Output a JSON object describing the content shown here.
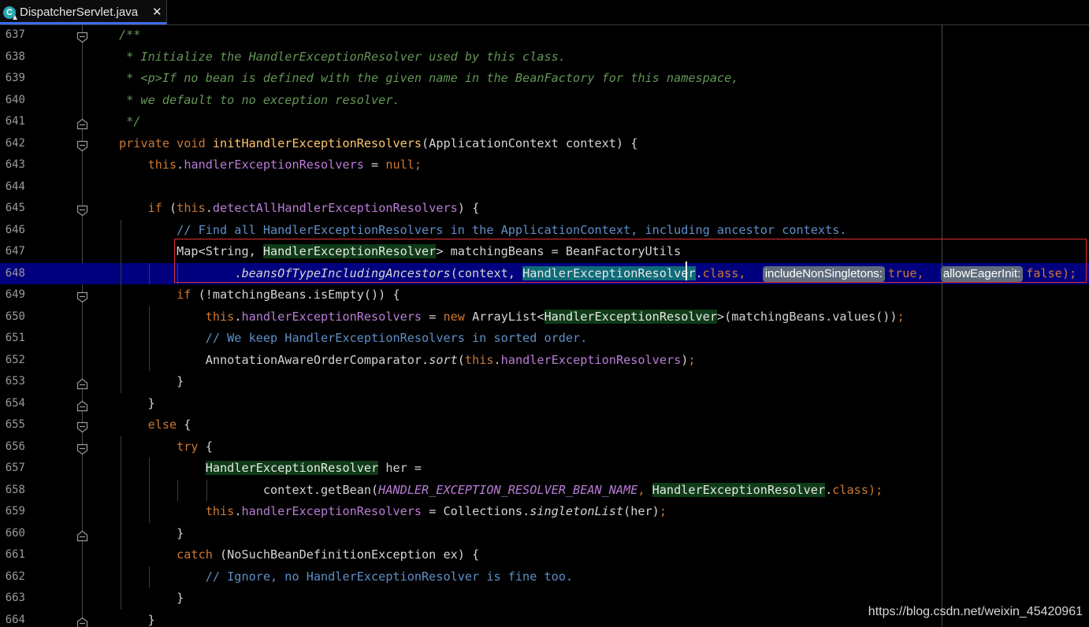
{
  "tab": {
    "title": "DispatcherServlet.java",
    "icon_letter": "C",
    "close_glyph": "✕"
  },
  "watermark": "https://blog.csdn.net/weixin_45420961",
  "current_line": "648",
  "lines": [
    {
      "n": "637",
      "fold": "open",
      "segs": [
        [
          "c-doc",
          "/**"
        ]
      ]
    },
    {
      "n": "638",
      "fold": "",
      "segs": [
        [
          "c-doc",
          " * Initialize the HandlerExceptionResolver used by this class."
        ]
      ]
    },
    {
      "n": "639",
      "fold": "",
      "segs": [
        [
          "c-doc",
          " * <p>If no bean is defined with the given name in the BeanFactory for this namespace,"
        ]
      ]
    },
    {
      "n": "640",
      "fold": "",
      "segs": [
        [
          "c-doc",
          " * we default to no exception resolver."
        ]
      ]
    },
    {
      "n": "641",
      "fold": "close",
      "segs": [
        [
          "c-doc",
          " */"
        ]
      ]
    },
    {
      "n": "642",
      "fold": "open",
      "segs": [
        [
          "c-kw",
          "private void "
        ],
        [
          "c-fn",
          "initHandlerExceptionResolvers"
        ],
        [
          "c-pl",
          "(ApplicationContext context) {"
        ]
      ]
    },
    {
      "n": "643",
      "fold": "",
      "segs": [
        [
          "c-kw",
          "    this"
        ],
        [
          "c-pl",
          "."
        ],
        [
          "c-fld",
          "handlerExceptionResolvers"
        ],
        [
          "c-pl",
          " = "
        ],
        [
          "c-kw",
          "null;"
        ]
      ]
    },
    {
      "n": "644",
      "fold": "",
      "segs": []
    },
    {
      "n": "645",
      "fold": "open",
      "segs": [
        [
          "c-kw",
          "    if "
        ],
        [
          "c-pl",
          "("
        ],
        [
          "c-kw",
          "this"
        ],
        [
          "c-pl",
          "."
        ],
        [
          "c-fld",
          "detectAllHandlerExceptionResolvers"
        ],
        [
          "c-pl",
          ") {"
        ]
      ]
    },
    {
      "n": "646",
      "fold": "",
      "segs": [
        [
          "c-com",
          "        // Find all HandlerExceptionResolvers in the ApplicationContext, including ancestor contexts."
        ]
      ]
    },
    {
      "n": "647",
      "fold": "",
      "segs": [
        [
          "c-pl",
          "        Map<String, "
        ],
        [
          "hl-type",
          "HandlerExceptionResolver"
        ],
        [
          "c-pl",
          "> matchingBeans = BeanFactoryUtils"
        ]
      ]
    },
    {
      "n": "648",
      "fold": "",
      "segs": [
        [
          "c-pl",
          "                ."
        ],
        [
          "c-it",
          "beansOfTypeIncludingAncestors"
        ],
        [
          "c-pl",
          "(context, "
        ],
        [
          "hl-sel",
          "HandlerExceptionResolver"
        ],
        [
          "c-pl",
          "."
        ],
        [
          "c-kw",
          "class, "
        ],
        [
          "hint",
          "includeNonSingletons:"
        ],
        [
          "c-kw",
          "true, "
        ],
        [
          "hint",
          "allowEagerInit:"
        ],
        [
          "c-kw",
          "false);"
        ]
      ]
    },
    {
      "n": "649",
      "fold": "open",
      "segs": [
        [
          "c-kw",
          "        if "
        ],
        [
          "c-pl",
          "(!matchingBeans.isEmpty()) {"
        ]
      ]
    },
    {
      "n": "650",
      "fold": "",
      "segs": [
        [
          "c-kw",
          "            this"
        ],
        [
          "c-pl",
          "."
        ],
        [
          "c-fld",
          "handlerExceptionResolvers"
        ],
        [
          "c-pl",
          " = "
        ],
        [
          "c-kw",
          "new "
        ],
        [
          "c-pl",
          "ArrayList<"
        ],
        [
          "hl-type",
          "HandlerExceptionResolver"
        ],
        [
          "c-pl",
          ">(matchingBeans.values())"
        ],
        [
          "c-kw",
          ";"
        ]
      ]
    },
    {
      "n": "651",
      "fold": "",
      "segs": [
        [
          "c-com",
          "            // We keep HandlerExceptionResolvers in sorted order."
        ]
      ]
    },
    {
      "n": "652",
      "fold": "",
      "segs": [
        [
          "c-pl",
          "            AnnotationAwareOrderComparator."
        ],
        [
          "c-it",
          "sort"
        ],
        [
          "c-pl",
          "("
        ],
        [
          "c-kw",
          "this"
        ],
        [
          "c-pl",
          "."
        ],
        [
          "c-fld",
          "handlerExceptionResolvers"
        ],
        [
          "c-pl",
          ")"
        ],
        [
          "c-kw",
          ";"
        ]
      ]
    },
    {
      "n": "653",
      "fold": "close",
      "segs": [
        [
          "c-pl",
          "        }"
        ]
      ]
    },
    {
      "n": "654",
      "fold": "close",
      "segs": [
        [
          "c-pl",
          "    }"
        ]
      ]
    },
    {
      "n": "655",
      "fold": "open",
      "segs": [
        [
          "c-kw",
          "    else "
        ],
        [
          "c-pl",
          "{"
        ]
      ]
    },
    {
      "n": "656",
      "fold": "open",
      "segs": [
        [
          "c-kw",
          "        try "
        ],
        [
          "c-pl",
          "{"
        ]
      ]
    },
    {
      "n": "657",
      "fold": "",
      "segs": [
        [
          "c-pl",
          "            "
        ],
        [
          "hl-type",
          "HandlerExceptionResolver"
        ],
        [
          "c-pl",
          " her ="
        ]
      ]
    },
    {
      "n": "658",
      "fold": "",
      "segs": [
        [
          "c-pl",
          "                    context.getBean("
        ],
        [
          "c-const",
          "HANDLER_EXCEPTION_RESOLVER_BEAN_NAME"
        ],
        [
          "c-kw",
          ", "
        ],
        [
          "hl-type",
          "HandlerExceptionResolver"
        ],
        [
          "c-pl",
          "."
        ],
        [
          "c-kw",
          "class);"
        ]
      ]
    },
    {
      "n": "659",
      "fold": "",
      "segs": [
        [
          "c-kw",
          "            this"
        ],
        [
          "c-pl",
          "."
        ],
        [
          "c-fld",
          "handlerExceptionResolvers"
        ],
        [
          "c-pl",
          " = Collections."
        ],
        [
          "c-it",
          "singletonList"
        ],
        [
          "c-pl",
          "(her)"
        ],
        [
          "c-kw",
          ";"
        ]
      ]
    },
    {
      "n": "660",
      "fold": "close",
      "segs": [
        [
          "c-pl",
          "        }"
        ]
      ]
    },
    {
      "n": "661",
      "fold": "",
      "segs": [
        [
          "c-kw",
          "        catch "
        ],
        [
          "c-pl",
          "(NoSuchBeanDefinitionException ex) {"
        ]
      ]
    },
    {
      "n": "662",
      "fold": "",
      "segs": [
        [
          "c-com",
          "            // Ignore, no HandlerExceptionResolver is fine too."
        ]
      ]
    },
    {
      "n": "663",
      "fold": "",
      "segs": [
        [
          "c-pl",
          "        }"
        ]
      ]
    },
    {
      "n": "664",
      "fold": "close",
      "segs": [
        [
          "c-pl",
          "    }"
        ]
      ]
    }
  ]
}
